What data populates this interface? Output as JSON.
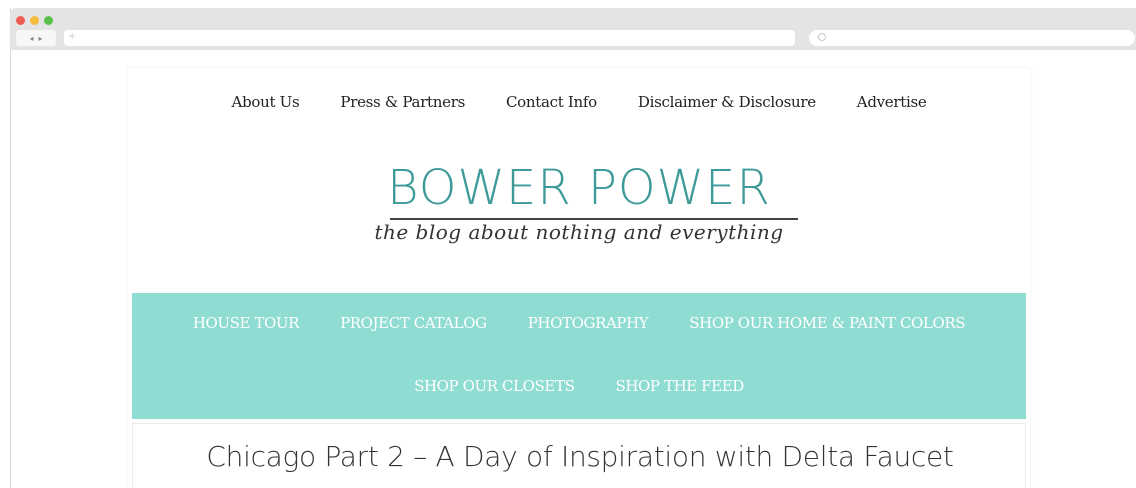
{
  "browser": {
    "nav_back": "◂",
    "nav_forward": "▸",
    "address_icon": "+",
    "icons": {
      "traffic": [
        "red-dot-icon",
        "yellow-dot-icon",
        "green-dot-icon"
      ],
      "search": "search-icon"
    },
    "colors": {
      "chrome": "#e4e4e4"
    }
  },
  "top_nav": {
    "items": [
      {
        "label": "About Us"
      },
      {
        "label": "Press & Partners"
      },
      {
        "label": "Contact Info"
      },
      {
        "label": "Disclaimer & Disclosure"
      },
      {
        "label": "Advertise"
      }
    ]
  },
  "logo": {
    "title": "BOWER POWER",
    "tagline": "the blog about nothing and everything",
    "colors": {
      "title": "#3e9a98",
      "tagline": "#333333"
    }
  },
  "main_nav": {
    "row1": [
      {
        "label": "HOUSE TOUR"
      },
      {
        "label": "PROJECT CATALOG"
      },
      {
        "label": "PHOTOGRAPHY"
      },
      {
        "label": "SHOP OUR HOME & PAINT COLORS"
      }
    ],
    "row2": [
      {
        "label": "SHOP OUR CLOSETS"
      },
      {
        "label": "SHOP THE FEED"
      }
    ],
    "colors": {
      "background": "#8fdcd2",
      "text": "#ffffff"
    }
  },
  "post": {
    "title": "Chicago Part 2 – A Day of Inspiration with Delta Faucet"
  }
}
